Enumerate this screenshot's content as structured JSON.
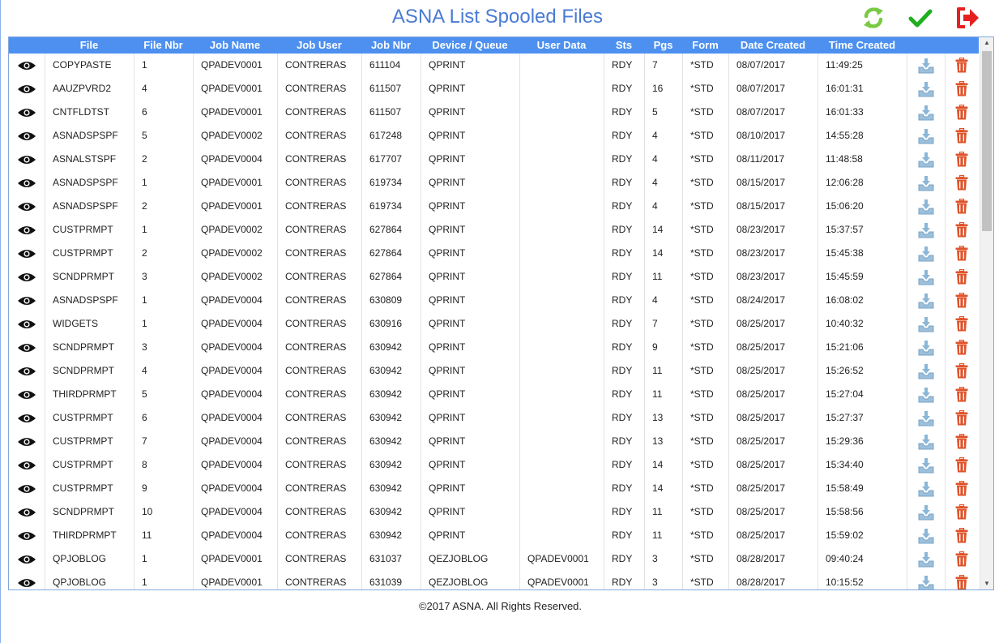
{
  "page": {
    "title": "ASNA List Spooled Files",
    "footer": "©2017 ASNA. All Rights Reserved."
  },
  "toolbar": {
    "refresh_icon": "refresh-icon",
    "confirm_icon": "checkmark-icon",
    "exit_icon": "sign-out-icon"
  },
  "colors": {
    "header_bg": "#4d90f0",
    "title": "#4a7bd3",
    "refresh": "#7ac943",
    "check": "#1fae1f",
    "exit": "#e52020",
    "delete": "#e0532a"
  },
  "columns": [
    "File",
    "File Nbr",
    "Job Name",
    "Job User",
    "Job Nbr",
    "Device / Queue",
    "User Data",
    "Sts",
    "Pgs",
    "Form",
    "Date Created",
    "Time Created"
  ],
  "rows": [
    [
      "COPYPASTE",
      "1",
      "QPADEV0001",
      "CONTRERAS",
      "611104",
      "QPRINT",
      "",
      "RDY",
      "7",
      "*STD",
      "08/07/2017",
      "11:49:25"
    ],
    [
      "AAUZPVRD2",
      "4",
      "QPADEV0001",
      "CONTRERAS",
      "611507",
      "QPRINT",
      "",
      "RDY",
      "16",
      "*STD",
      "08/07/2017",
      "16:01:31"
    ],
    [
      "CNTFLDTST",
      "6",
      "QPADEV0001",
      "CONTRERAS",
      "611507",
      "QPRINT",
      "",
      "RDY",
      "5",
      "*STD",
      "08/07/2017",
      "16:01:33"
    ],
    [
      "ASNADSPSPF",
      "5",
      "QPADEV0002",
      "CONTRERAS",
      "617248",
      "QPRINT",
      "",
      "RDY",
      "4",
      "*STD",
      "08/10/2017",
      "14:55:28"
    ],
    [
      "ASNALSTSPF",
      "2",
      "QPADEV0004",
      "CONTRERAS",
      "617707",
      "QPRINT",
      "",
      "RDY",
      "4",
      "*STD",
      "08/11/2017",
      "11:48:58"
    ],
    [
      "ASNADSPSPF",
      "1",
      "QPADEV0001",
      "CONTRERAS",
      "619734",
      "QPRINT",
      "",
      "RDY",
      "4",
      "*STD",
      "08/15/2017",
      "12:06:28"
    ],
    [
      "ASNADSPSPF",
      "2",
      "QPADEV0001",
      "CONTRERAS",
      "619734",
      "QPRINT",
      "",
      "RDY",
      "4",
      "*STD",
      "08/15/2017",
      "15:06:20"
    ],
    [
      "CUSTPRMPT",
      "1",
      "QPADEV0002",
      "CONTRERAS",
      "627864",
      "QPRINT",
      "",
      "RDY",
      "14",
      "*STD",
      "08/23/2017",
      "15:37:57"
    ],
    [
      "CUSTPRMPT",
      "2",
      "QPADEV0002",
      "CONTRERAS",
      "627864",
      "QPRINT",
      "",
      "RDY",
      "14",
      "*STD",
      "08/23/2017",
      "15:45:38"
    ],
    [
      "SCNDPRMPT",
      "3",
      "QPADEV0002",
      "CONTRERAS",
      "627864",
      "QPRINT",
      "",
      "RDY",
      "11",
      "*STD",
      "08/23/2017",
      "15:45:59"
    ],
    [
      "ASNADSPSPF",
      "1",
      "QPADEV0004",
      "CONTRERAS",
      "630809",
      "QPRINT",
      "",
      "RDY",
      "4",
      "*STD",
      "08/24/2017",
      "16:08:02"
    ],
    [
      "WIDGETS",
      "1",
      "QPADEV0004",
      "CONTRERAS",
      "630916",
      "QPRINT",
      "",
      "RDY",
      "7",
      "*STD",
      "08/25/2017",
      "10:40:32"
    ],
    [
      "SCNDPRMPT",
      "3",
      "QPADEV0004",
      "CONTRERAS",
      "630942",
      "QPRINT",
      "",
      "RDY",
      "9",
      "*STD",
      "08/25/2017",
      "15:21:06"
    ],
    [
      "SCNDPRMPT",
      "4",
      "QPADEV0004",
      "CONTRERAS",
      "630942",
      "QPRINT",
      "",
      "RDY",
      "11",
      "*STD",
      "08/25/2017",
      "15:26:52"
    ],
    [
      "THIRDPRMPT",
      "5",
      "QPADEV0004",
      "CONTRERAS",
      "630942",
      "QPRINT",
      "",
      "RDY",
      "11",
      "*STD",
      "08/25/2017",
      "15:27:04"
    ],
    [
      "CUSTPRMPT",
      "6",
      "QPADEV0004",
      "CONTRERAS",
      "630942",
      "QPRINT",
      "",
      "RDY",
      "13",
      "*STD",
      "08/25/2017",
      "15:27:37"
    ],
    [
      "CUSTPRMPT",
      "7",
      "QPADEV0004",
      "CONTRERAS",
      "630942",
      "QPRINT",
      "",
      "RDY",
      "13",
      "*STD",
      "08/25/2017",
      "15:29:36"
    ],
    [
      "CUSTPRMPT",
      "8",
      "QPADEV0004",
      "CONTRERAS",
      "630942",
      "QPRINT",
      "",
      "RDY",
      "14",
      "*STD",
      "08/25/2017",
      "15:34:40"
    ],
    [
      "CUSTPRMPT",
      "9",
      "QPADEV0004",
      "CONTRERAS",
      "630942",
      "QPRINT",
      "",
      "RDY",
      "14",
      "*STD",
      "08/25/2017",
      "15:58:49"
    ],
    [
      "SCNDPRMPT",
      "10",
      "QPADEV0004",
      "CONTRERAS",
      "630942",
      "QPRINT",
      "",
      "RDY",
      "11",
      "*STD",
      "08/25/2017",
      "15:58:56"
    ],
    [
      "THIRDPRMPT",
      "11",
      "QPADEV0004",
      "CONTRERAS",
      "630942",
      "QPRINT",
      "",
      "RDY",
      "11",
      "*STD",
      "08/25/2017",
      "15:59:02"
    ],
    [
      "QPJOBLOG",
      "1",
      "QPADEV0001",
      "CONTRERAS",
      "631037",
      "QEZJOBLOG",
      "QPADEV0001",
      "RDY",
      "3",
      "*STD",
      "08/28/2017",
      "09:40:24"
    ],
    [
      "QPJOBLOG",
      "1",
      "QPADEV0001",
      "CONTRERAS",
      "631039",
      "QEZJOBLOG",
      "QPADEV0001",
      "RDY",
      "3",
      "*STD",
      "08/28/2017",
      "10:15:52"
    ]
  ],
  "row_icons": {
    "view": "eye-icon",
    "download": "download-tray-icon",
    "delete": "trash-icon"
  }
}
